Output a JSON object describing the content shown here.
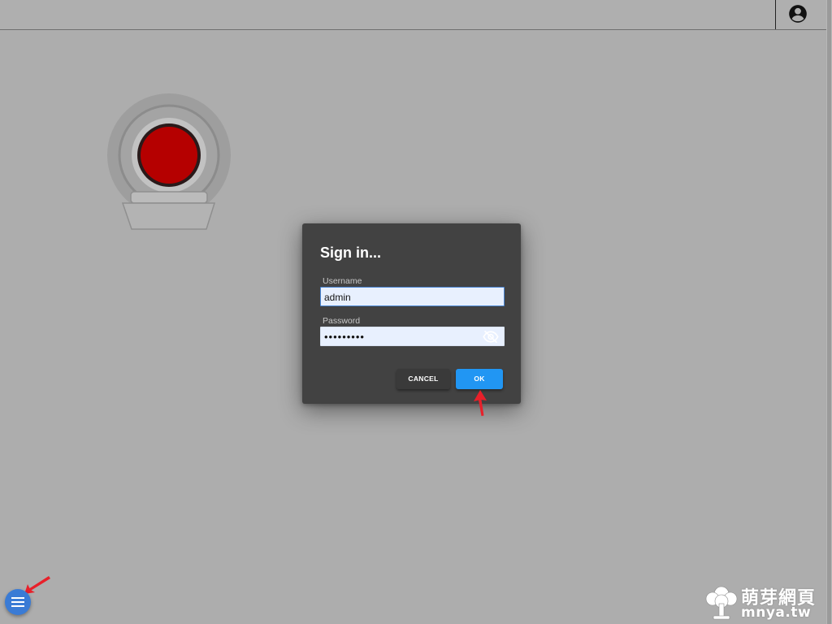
{
  "topbar": {
    "account_icon": "account-circle-icon"
  },
  "dialog": {
    "title": "Sign in...",
    "username_label": "Username",
    "username_value": "admin",
    "password_label": "Password",
    "password_value": "•••••••••",
    "password_toggle_icon": "eye-off-icon",
    "cancel_label": "CANCEL",
    "ok_label": "OK"
  },
  "fab": {
    "icon": "menu-icon"
  },
  "watermark": {
    "cn": "萌芽網頁",
    "url": "mnya.tw"
  },
  "colors": {
    "background": "#adadad",
    "dialog_bg": "#424242",
    "ok_button": "#2196f3",
    "fab": "#3a7bd5",
    "annotation_arrow": "#e8202a",
    "bell_red": "#b50000"
  }
}
